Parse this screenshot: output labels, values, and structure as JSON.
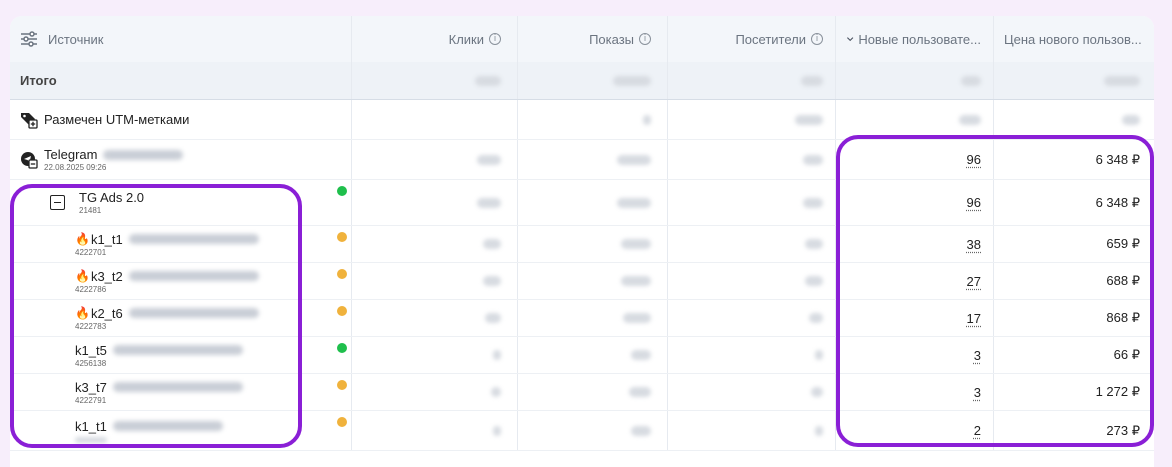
{
  "columns": {
    "source": "Источник",
    "clicks": "Клики",
    "impressions": "Показы",
    "visitors": "Посетители",
    "new_users": "Новые пользовате...",
    "new_user_price": "Цена нового пользов..."
  },
  "total": {
    "label": "Итого"
  },
  "rows": [
    {
      "name": "Размечен UTM-метками",
      "id": "",
      "new_users": "",
      "price": ""
    },
    {
      "name": "Telegram",
      "id": "22.08.2025 09:26",
      "new_users": "96",
      "price": "6 348 ₽"
    },
    {
      "name": "TG Ads 2.0",
      "id": "21481",
      "new_users": "96",
      "price": "6 348 ₽",
      "status": "green"
    },
    {
      "name": "k1_t1",
      "id": "4222701",
      "new_users": "38",
      "price": "659 ₽",
      "status": "orange",
      "fire": true
    },
    {
      "name": "k3_t2",
      "id": "4222786",
      "new_users": "27",
      "price": "688 ₽",
      "status": "orange",
      "fire": true
    },
    {
      "name": "k2_t6",
      "id": "4222783",
      "new_users": "17",
      "price": "868 ₽",
      "status": "orange",
      "fire": true
    },
    {
      "name": "k1_t5",
      "id": "4256138",
      "new_users": "3",
      "price": "66 ₽",
      "status": "green"
    },
    {
      "name": "k3_t7",
      "id": "4222791",
      "new_users": "3",
      "price": "1 272 ₽",
      "status": "orange"
    },
    {
      "name": "k1_t1",
      "id": "",
      "new_users": "2",
      "price": "273 ₽",
      "status": "orange"
    }
  ],
  "icons": {
    "filter": "filter-sliders-icon",
    "sort": "chevron-down-icon",
    "info": "info-icon",
    "utm": "tag-plus-icon",
    "telegram": "telegram-minus-icon",
    "collapse": "minus-square-icon",
    "fire": "fire-icon"
  },
  "colors": {
    "highlight": "#8a1fd6",
    "status_green": "#1fbf4c",
    "status_orange": "#f0b23c"
  }
}
